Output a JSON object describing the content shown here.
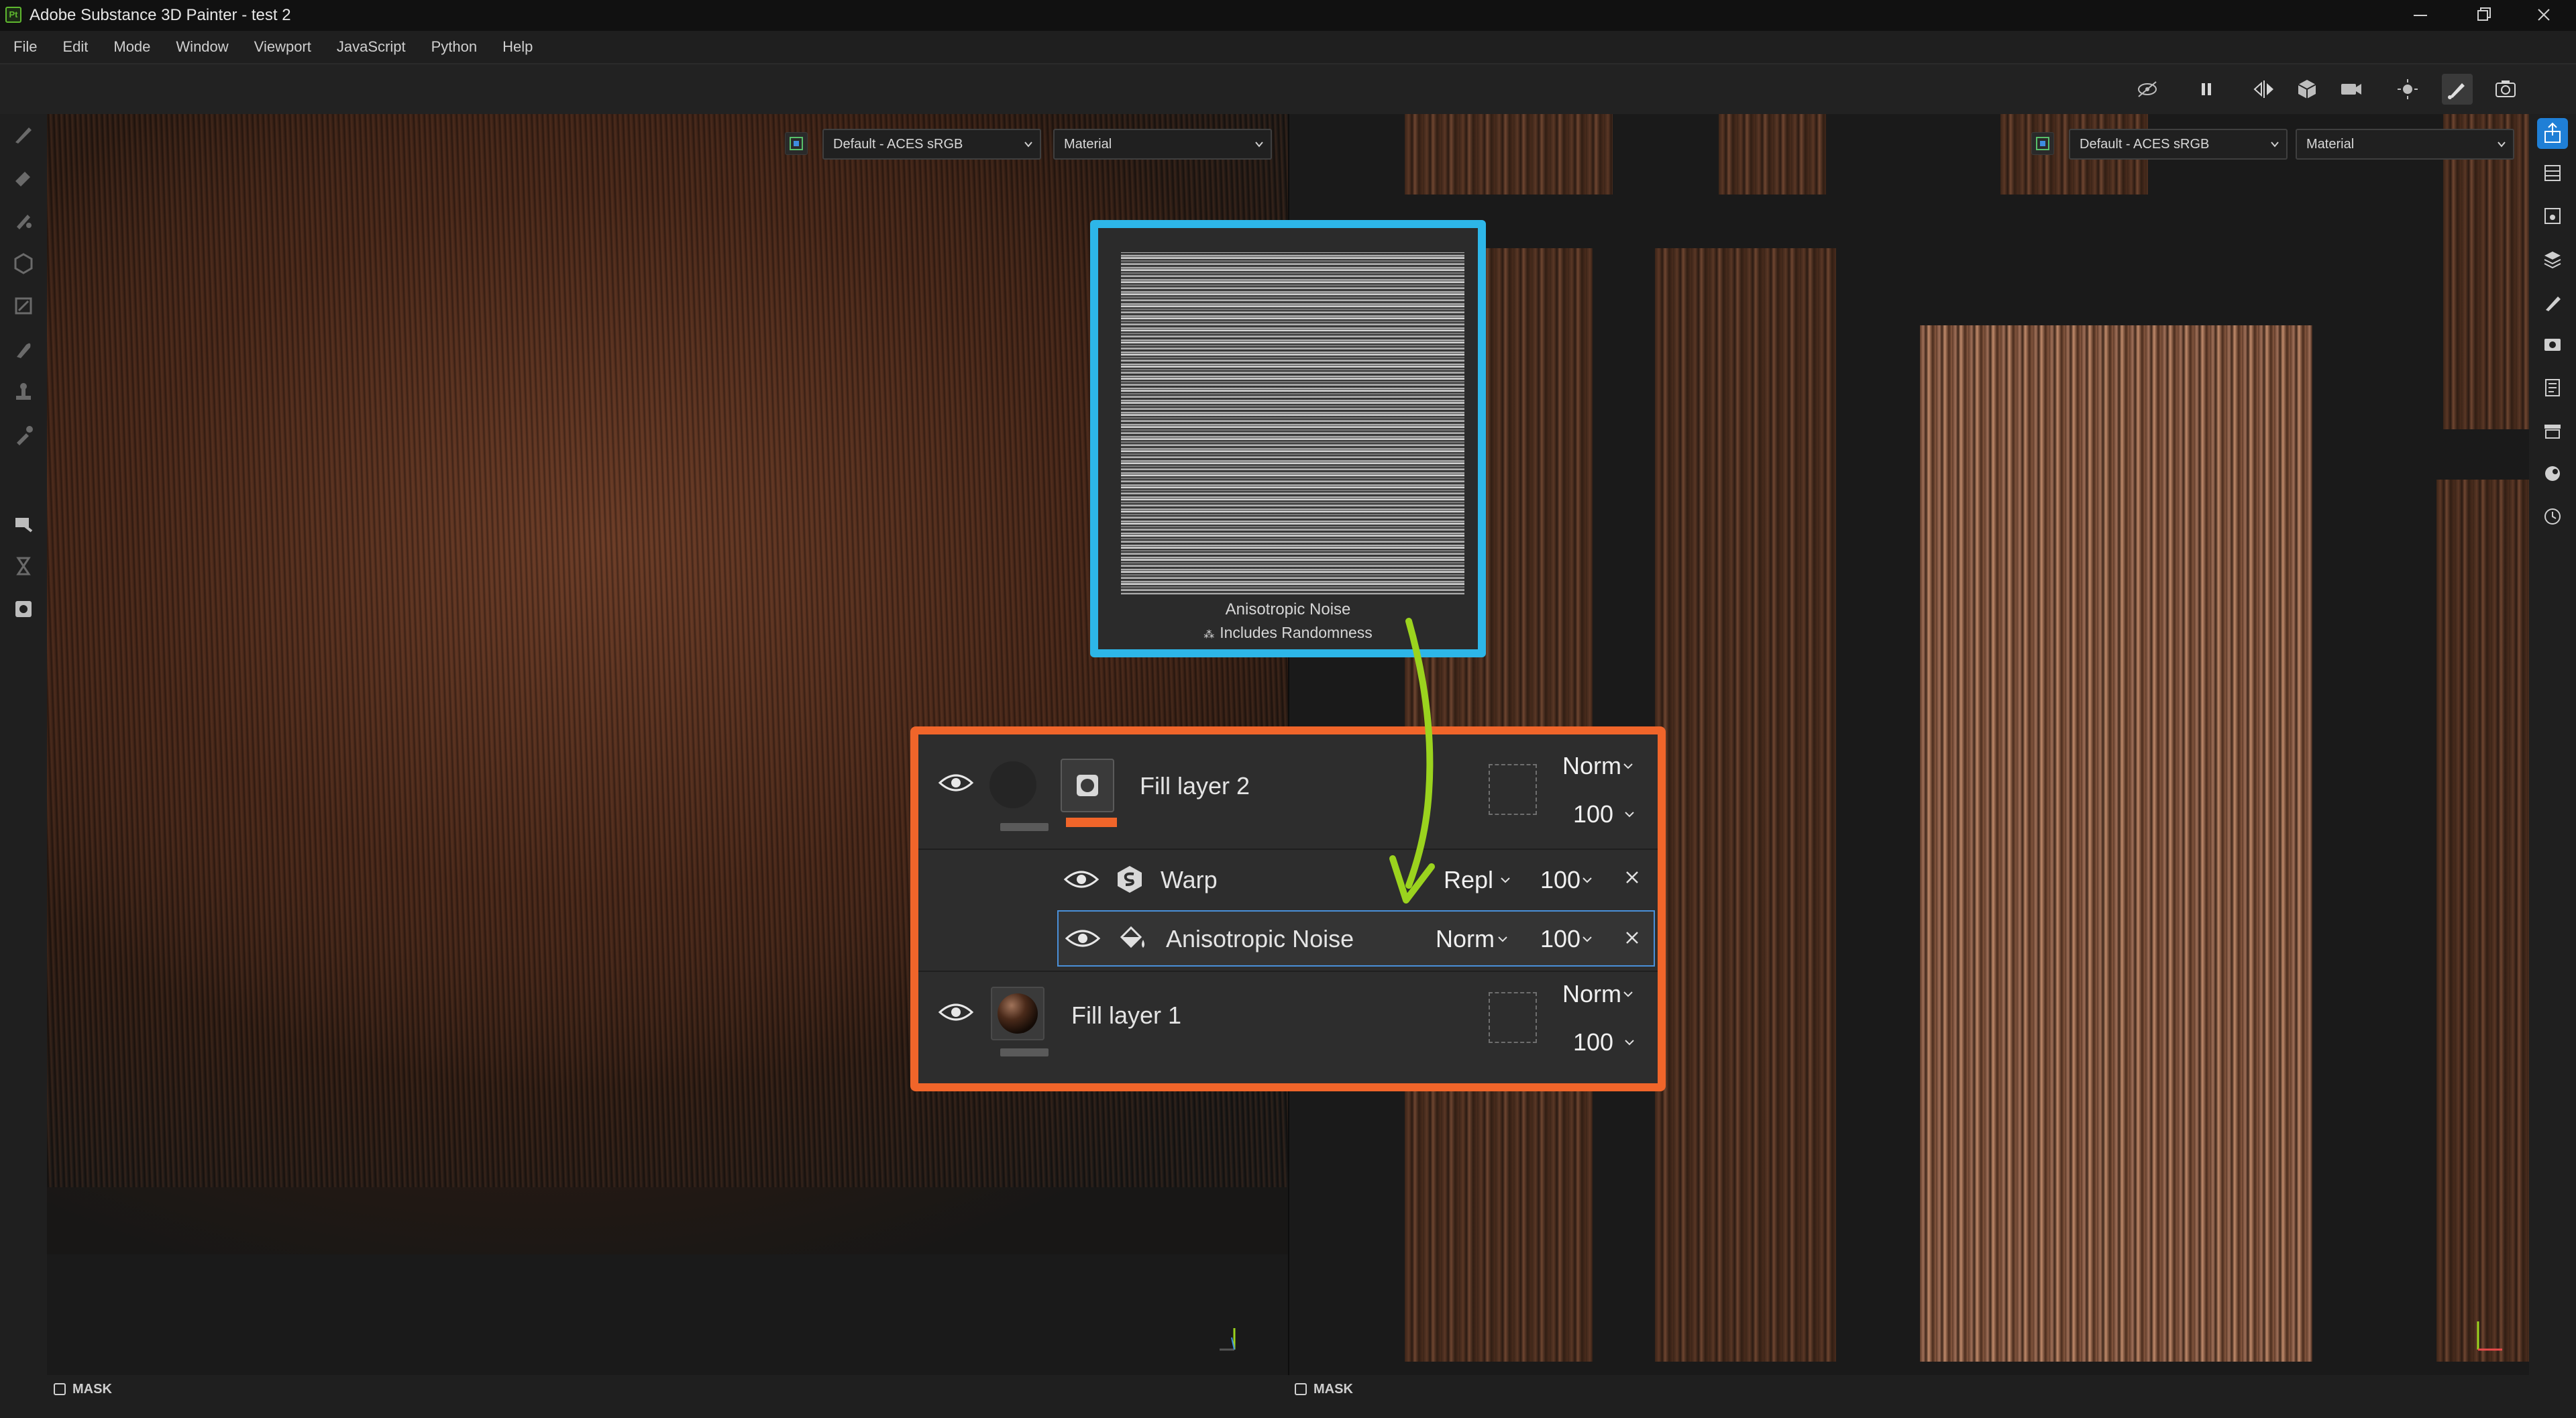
{
  "window": {
    "title": "Adobe Substance 3D Painter - test 2"
  },
  "menu": {
    "items": [
      "File",
      "Edit",
      "Mode",
      "Window",
      "Viewport",
      "JavaScript",
      "Python",
      "Help"
    ]
  },
  "viewport_3d": {
    "colorspace": "Default - ACES sRGB",
    "channel": "Material",
    "mask_label": "MASK"
  },
  "viewport_2d": {
    "colorspace": "Default - ACES sRGB",
    "channel": "Material",
    "mask_label": "MASK"
  },
  "preview": {
    "name": "Anisotropic Noise",
    "note": "Includes Randomness"
  },
  "layers": {
    "fill2": {
      "name": "Fill layer 2",
      "blend": "Norm",
      "opacity": "100"
    },
    "warp": {
      "name": "Warp",
      "blend": "Repl",
      "opacity": "100"
    },
    "aniso": {
      "name": "Anisotropic Noise",
      "blend": "Norm",
      "opacity": "100"
    },
    "fill1": {
      "name": "Fill layer 1",
      "blend": "Norm",
      "opacity": "100"
    }
  },
  "colors": {
    "highlight_blue": "#2db6e8",
    "highlight_orange": "#f0652a",
    "arrow_green": "#9bd31e",
    "selection_blue": "#4a90d9"
  }
}
